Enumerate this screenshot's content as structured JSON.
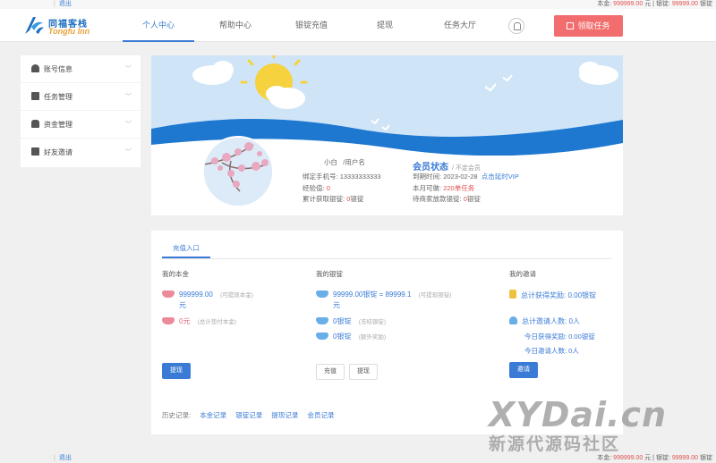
{
  "topbar": {
    "logout": "退出",
    "balance_label": "本金:",
    "balance_value": "999999.00",
    "balance_unit": "元",
    "silver_label": "银锭:",
    "silver_value": "99999.00",
    "silver_unit": "银锭"
  },
  "header": {
    "logo_cn": "同福客栈",
    "logo_en": "Tongfu Inn",
    "tabs": [
      {
        "label": "个人中心",
        "active": true
      },
      {
        "label": "帮助中心"
      },
      {
        "label": "银锭充值"
      },
      {
        "label": "提现"
      },
      {
        "label": "任务大厅"
      }
    ],
    "claim_task": "领取任务"
  },
  "sidebar": {
    "items": [
      {
        "label": "账号信息",
        "icon": "user-icon"
      },
      {
        "label": "任务管理",
        "icon": "list-icon"
      },
      {
        "label": "资金管理",
        "icon": "wallet-icon"
      },
      {
        "label": "好友邀请",
        "icon": "mail-icon"
      }
    ]
  },
  "profile": {
    "nickname": "小白",
    "username": "用户名",
    "phone_label": "绑定手机号:",
    "phone_value": "13333333333",
    "points_label": "经验值:",
    "points_value": "0",
    "earned_label": "累计获取银锭:",
    "earned_value": "0",
    "earned_unit": "银锭",
    "member_title": "会员状态",
    "member_sub": "/ 不定会员",
    "expire_label": "到期时间:",
    "expire_value": "2023-02-28",
    "vip_link": "点击延时VIP",
    "monthly_label": "本月可做:",
    "monthly_value": "220单任务",
    "pending_label": "待商家放款银锭:",
    "pending_value": "0",
    "pending_unit": "银锭"
  },
  "panel": {
    "tab": "充值入口",
    "principal": {
      "title": "我的本金",
      "amount": "999999.00",
      "amount_unit": "元",
      "amount_note": "(可提现本金)",
      "frozen": "0元",
      "frozen_note": "(总计垫付本金)",
      "withdraw_btn": "提现"
    },
    "silver": {
      "title": "我的银锭",
      "amount": "99999.00银锭 = 89999.1",
      "amount_unit": "元",
      "amount_note": "(可提现银锭)",
      "frozen": "0银锭",
      "frozen_note": "(冻结银锭)",
      "reward": "0银锭",
      "reward_note": "(额外奖励)",
      "recharge_btn": "充值",
      "withdraw_btn": "提现"
    },
    "invite": {
      "title": "我的邀请",
      "total_reward": "总计获得奖励: 0.00银锭",
      "total_invited": "总计邀请人数: 0人",
      "today_reward": "今日获得奖励: 0.00银锭",
      "today_invited": "今日邀请人数: 0人",
      "invite_btn": "邀请"
    },
    "history": {
      "label": "历史记录:",
      "links": [
        "本金记录",
        "银锭记录",
        "提现记录",
        "会员记录"
      ]
    }
  },
  "watermark": {
    "line1": "XYDai.cn",
    "line2": "新源代源码社区"
  },
  "colors": {
    "accent": "#3a7bd5",
    "danger": "#f26d6d",
    "sky": "#cfe5f7",
    "wave": "#1e78d0"
  }
}
